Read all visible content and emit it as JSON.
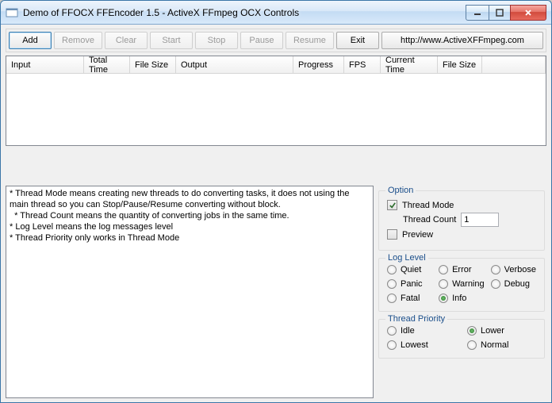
{
  "window": {
    "title": "Demo of FFOCX FFEncoder 1.5 - ActiveX FFmpeg OCX Controls"
  },
  "toolbar": {
    "add": "Add",
    "remove": "Remove",
    "clear": "Clear",
    "start": "Start",
    "stop": "Stop",
    "pause": "Pause",
    "resume": "Resume",
    "exit": "Exit",
    "link": "http://www.ActiveXFFmpeg.com"
  },
  "grid": {
    "cols": [
      "Input",
      "Total Time",
      "File Size",
      "Output",
      "Progress",
      "FPS",
      "Current Time",
      "File Size"
    ],
    "widths": [
      98,
      58,
      58,
      148,
      64,
      46,
      72,
      56
    ]
  },
  "log": {
    "l1": "* Thread Mode means creating new threads to do converting tasks, it does not using the",
    "l2": "main thread so you can Stop/Pause/Resume converting without block.",
    "l3": "  * Thread Count means the quantity of converting jobs in the same time.",
    "l4": "* Log Level means the log messages level",
    "l5": "* Thread Priority only works in Thread Mode"
  },
  "option": {
    "group": "Option",
    "threadmode": "Thread Mode",
    "threadcount_lbl": "Thread Count",
    "threadcount_val": "1",
    "preview": "Preview"
  },
  "loglevel": {
    "group": "Log Level",
    "items": {
      "quiet": "Quiet",
      "error": "Error",
      "verbose": "Verbose",
      "panic": "Panic",
      "warning": "Warning",
      "debug": "Debug",
      "fatal": "Fatal",
      "info": "Info"
    }
  },
  "priority": {
    "group": "Thread Priority",
    "items": {
      "idle": "Idle",
      "lower": "Lower",
      "lowest": "Lowest",
      "normal": "Normal"
    }
  }
}
